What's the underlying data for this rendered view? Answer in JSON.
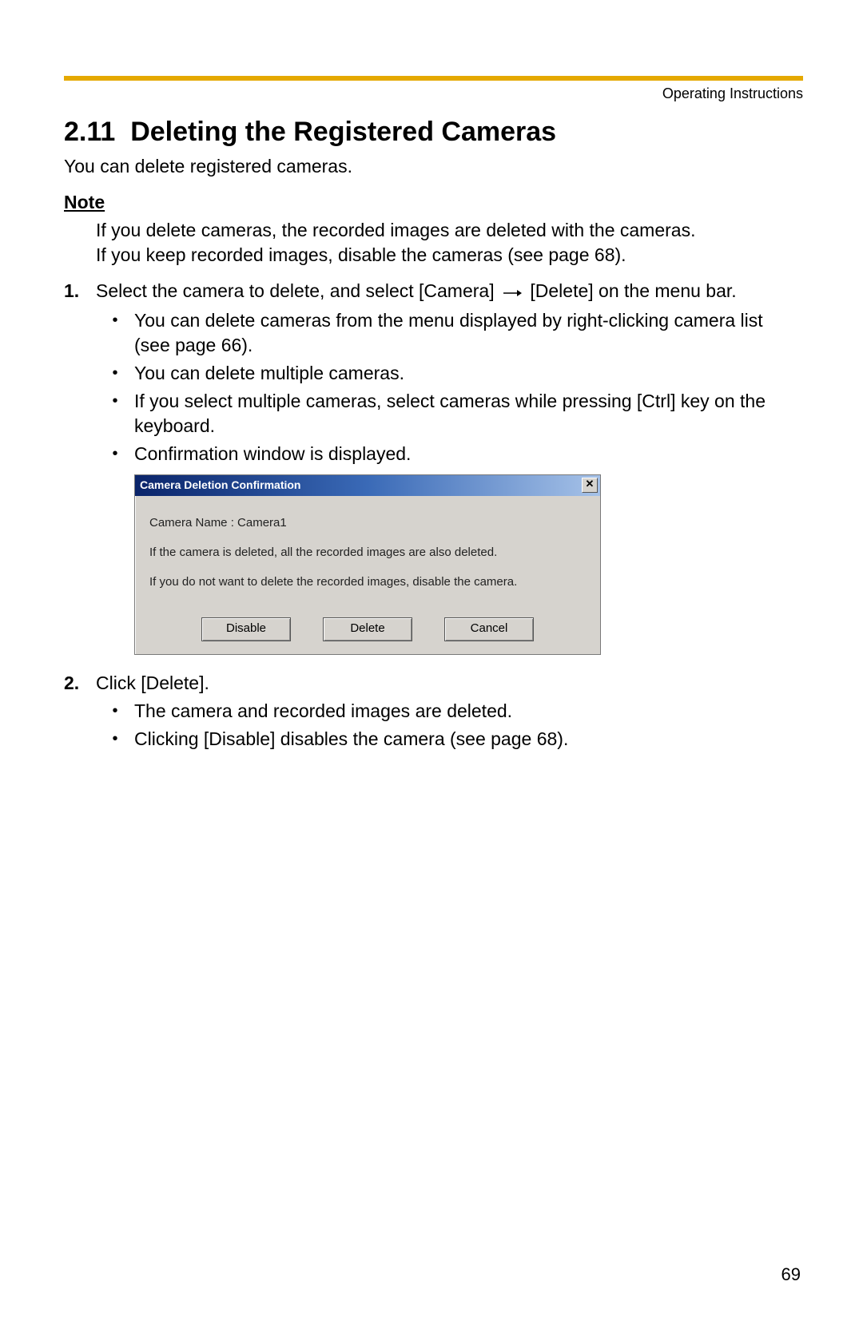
{
  "header": {
    "label": "Operating Instructions"
  },
  "section": {
    "number": "2.11",
    "title": "Deleting the Registered Cameras",
    "intro": "You can delete registered cameras."
  },
  "note": {
    "heading": "Note",
    "line1": "If you delete cameras, the recorded images are deleted with the cameras.",
    "line2": "If you keep recorded images, disable the cameras (see page 68)."
  },
  "steps": [
    {
      "num": "1.",
      "text_before": "Select the camera to delete, and select [Camera]",
      "text_after": "[Delete] on the menu bar.",
      "bullets": [
        "You can delete cameras from the menu displayed by right-clicking camera list (see page 66).",
        "You can delete multiple cameras.",
        "If you select multiple cameras, select cameras while pressing [Ctrl] key on the keyboard.",
        "Confirmation window is displayed."
      ]
    },
    {
      "num": "2.",
      "text": "Click [Delete].",
      "bullets": [
        "The camera and recorded images are deleted.",
        "Clicking [Disable] disables the camera (see page 68)."
      ]
    }
  ],
  "dialog": {
    "title": "Camera Deletion Confirmation",
    "camera_label": "Camera Name :  Camera1",
    "line1": "If the camera is deleted, all the recorded images are also deleted.",
    "line2": "If you do not want to delete the recorded images, disable the camera.",
    "buttons": {
      "disable": "Disable",
      "delete": "Delete",
      "cancel": "Cancel"
    }
  },
  "page_number": "69"
}
